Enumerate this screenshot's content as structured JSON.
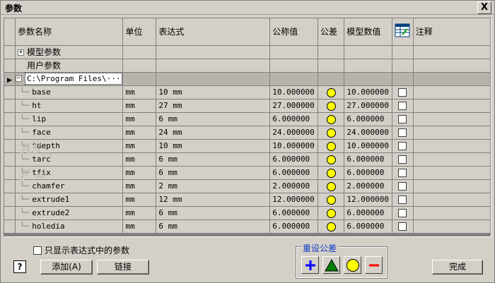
{
  "window": {
    "title": "参数",
    "close_label": "X"
  },
  "columns": {
    "name": "参数名称",
    "unit": "单位",
    "expression": "表达式",
    "nominal": "公称值",
    "tolerance": "公差",
    "model_value": "模型数值",
    "notes": "注释"
  },
  "groups": {
    "model_params": "模型参数",
    "user_params": "用户参数",
    "file_node": "C:\\Program Files\\···"
  },
  "tree_symbols": {
    "plus": "+",
    "minus": "−"
  },
  "rows": [
    {
      "name": "base",
      "unit": "mm",
      "expr": "10 mm",
      "nominal": "10.000000",
      "model": "10.000000"
    },
    {
      "name": "ht",
      "unit": "mm",
      "expr": "27 mm",
      "nominal": "27.000000",
      "model": "27.000000"
    },
    {
      "name": "lip",
      "unit": "mm",
      "expr": "6 mm",
      "nominal": "6.000000",
      "model": "6.000000"
    },
    {
      "name": "face",
      "unit": "mm",
      "expr": "24 mm",
      "nominal": "24.000000",
      "model": "24.000000"
    },
    {
      "name": "tdepth",
      "unit": "mm",
      "expr": "10 mm",
      "nominal": "10.000000",
      "model": "10.000000"
    },
    {
      "name": "tarc",
      "unit": "mm",
      "expr": "6 mm",
      "nominal": "6.000000",
      "model": "6.000000"
    },
    {
      "name": "tfix",
      "unit": "mm",
      "expr": "6 mm",
      "nominal": "6.000000",
      "model": "6.000000"
    },
    {
      "name": "chamfer",
      "unit": "mm",
      "expr": "2 mm",
      "nominal": "2.000000",
      "model": "2.000000"
    },
    {
      "name": "extrude1",
      "unit": "mm",
      "expr": "12 mm",
      "nominal": "12.000000",
      "model": "12.000000"
    },
    {
      "name": "extrude2",
      "unit": "mm",
      "expr": "6 mm",
      "nominal": "6.000000",
      "model": "6.000000"
    },
    {
      "name": "holedia",
      "unit": "mm",
      "expr": "6 mm",
      "nominal": "6.000000",
      "model": "6.000000"
    }
  ],
  "bottom": {
    "show_expr_only": "只显示表达式中的参数",
    "help": "?",
    "add": "添加(A)",
    "link": "链接",
    "reset_tolerance": "重设公差",
    "done": "完成"
  },
  "colors": {
    "tolerance_dot": "#ffff00",
    "plus_blue": "#0000ff",
    "triangle_green": "#008000",
    "minus_red": "#ff0000",
    "group_label_blue": "#1038c8"
  },
  "icons": {
    "notes_header": "export-table-icon",
    "tol_upper": "plus-icon",
    "tol_median": "triangle-icon",
    "tol_nominal": "circle-icon",
    "tol_lower": "minus-icon"
  }
}
